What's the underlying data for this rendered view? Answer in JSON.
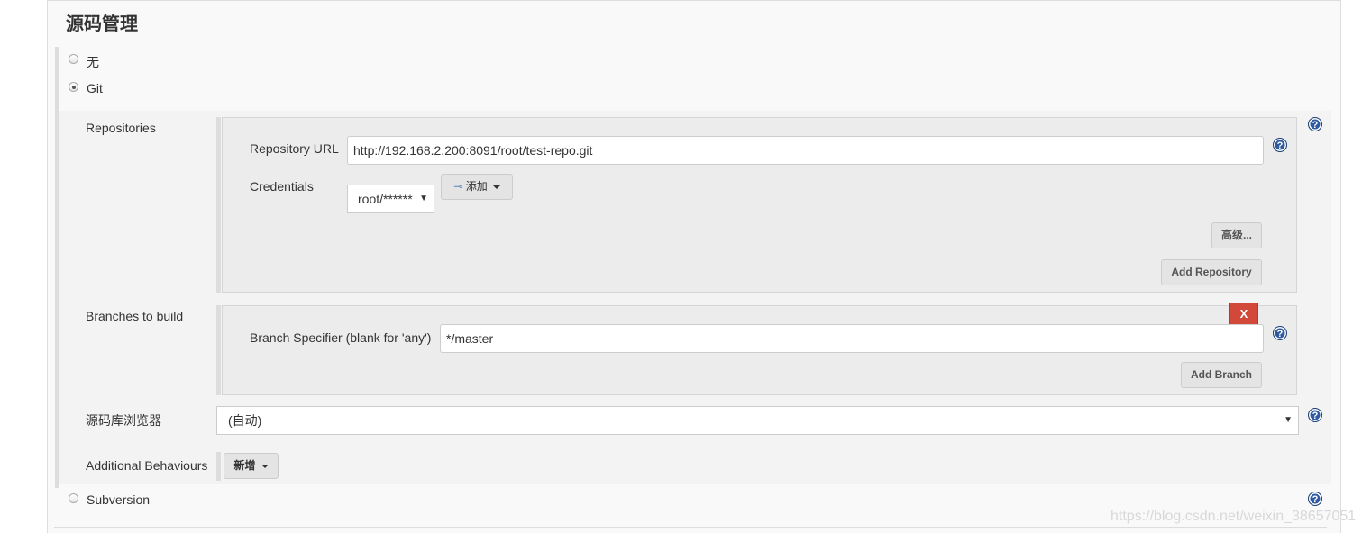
{
  "section_title": "源码管理",
  "scm_options": [
    {
      "label": "无",
      "selected": false
    },
    {
      "label": "Git",
      "selected": true
    },
    {
      "label": "Subversion",
      "selected": false
    }
  ],
  "git": {
    "repositories_label": "Repositories",
    "repo_url_label": "Repository URL",
    "repo_url_value": "http://192.168.2.200:8091/root/test-repo.git",
    "credentials_label": "Credentials",
    "credentials_value": "root/******",
    "add_credentials_label": "添加",
    "advanced_label": "高级...",
    "add_repository_label": "Add Repository",
    "branches_label": "Branches to build",
    "branch_specifier_label": "Branch Specifier (blank for 'any')",
    "branch_specifier_value": "*/master",
    "delete_branch_label": "X",
    "add_branch_label": "Add Branch",
    "repo_browser_label": "源码库浏览器",
    "repo_browser_value": "(自动)",
    "additional_behaviours_label": "Additional Behaviours",
    "add_behaviour_label": "新增"
  },
  "help_icon": "?",
  "watermark": "https://blog.csdn.net/weixin_38657051",
  "colors": {
    "delete": "#d24939",
    "help": "#2f5aa0"
  }
}
